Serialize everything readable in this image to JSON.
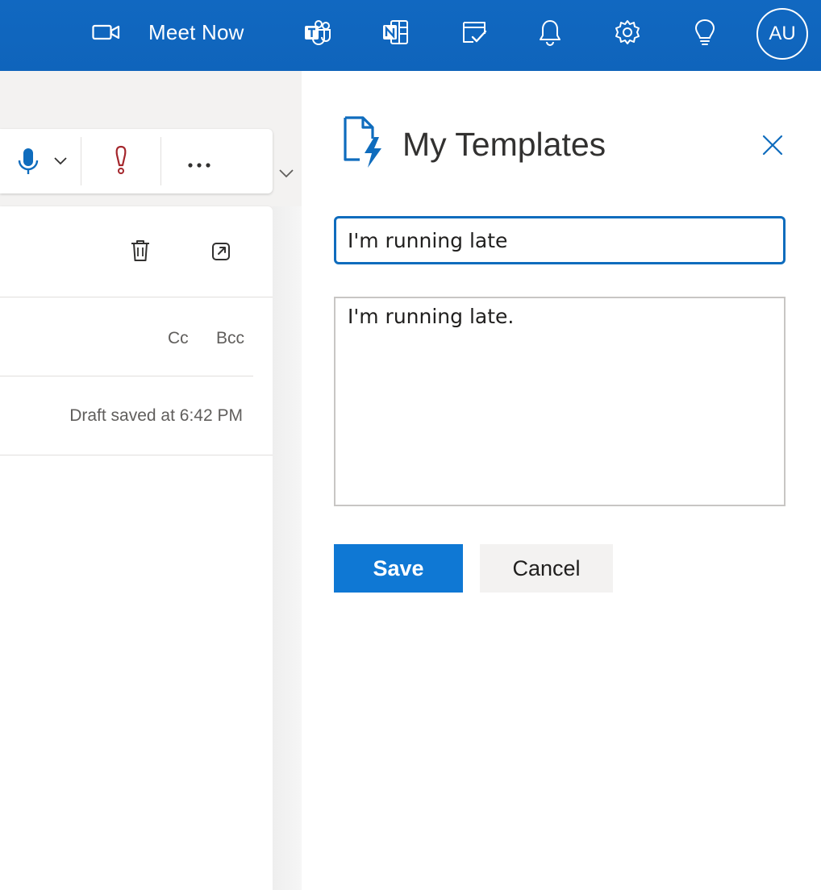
{
  "topbar": {
    "meet_now_label": "Meet Now",
    "avatar_initials": "AU",
    "icons": [
      "video-camera-icon",
      "teams-icon",
      "onenote-icon",
      "todo-icon",
      "bell-icon",
      "gear-icon",
      "lightbulb-icon"
    ]
  },
  "compose": {
    "cc_label": "Cc",
    "bcc_label": "Bcc",
    "draft_status": "Draft saved at 6:42 PM",
    "ribbon_icons": [
      "microphone-icon",
      "chevron-down-icon",
      "importance-icon",
      "more-icon"
    ],
    "header_icons": [
      "trash-icon",
      "popout-icon"
    ]
  },
  "templates": {
    "title": "My Templates",
    "template_title_value": "I'm running late",
    "template_body_value": "I'm running late.",
    "save_label": "Save",
    "cancel_label": "Cancel"
  },
  "colors": {
    "brand_blue": "#0f6cbd",
    "primary_button": "#0f78d4",
    "importance_red": "#a4262c"
  }
}
